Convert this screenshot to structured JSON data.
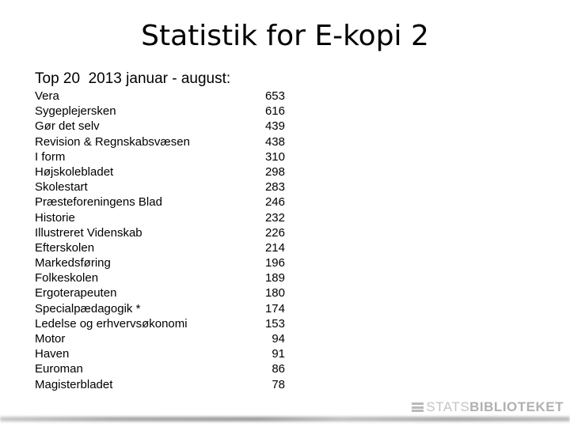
{
  "slide": {
    "title": "Statistik for E-kopi 2",
    "subtitle": "Top 20  2013 januar - august:",
    "items": [
      {
        "name": "Vera",
        "value": "653"
      },
      {
        "name": "Sygeplejersken",
        "value": "616"
      },
      {
        "name": "Gør det selv",
        "value": "439"
      },
      {
        "name": "Revision & Regnskabsvæsen",
        "value": "438"
      },
      {
        "name": "I form",
        "value": "310"
      },
      {
        "name": "Højskolebladet",
        "value": "298"
      },
      {
        "name": "Skolestart",
        "value": "283"
      },
      {
        "name": "Præsteforeningens Blad",
        "value": "246"
      },
      {
        "name": "Historie",
        "value": "232"
      },
      {
        "name": "Illustreret Videnskab",
        "value": "226"
      },
      {
        "name": "Efterskolen",
        "value": "214"
      },
      {
        "name": "Markedsføring",
        "value": "196"
      },
      {
        "name": "Folkeskolen",
        "value": "189"
      },
      {
        "name": "Ergoterapeuten",
        "value": "180"
      },
      {
        "name": "Specialpædagogik *",
        "value": "174"
      },
      {
        "name": "Ledelse og erhvervsøkonomi",
        "value": "153"
      },
      {
        "name": "Motor",
        "value": "94"
      },
      {
        "name": "Haven",
        "value": "91"
      },
      {
        "name": "Euroman",
        "value": "86"
      },
      {
        "name": "Magisterbladet",
        "value": "78"
      }
    ]
  },
  "logo": {
    "icon": "stacked-bars-icon",
    "light_text": "STATS",
    "bold_text": "BIBLIOTEKET",
    "color": "#b9b9b9"
  }
}
